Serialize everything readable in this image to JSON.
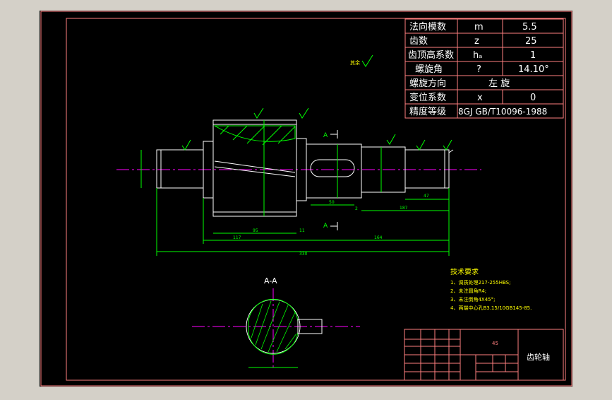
{
  "colors": {
    "app_bg": "#d4d0c8",
    "canvas_bg": "#000000",
    "frame": "#ff7f7f",
    "geometry": "#ffffff",
    "dimension": "#00ff00",
    "centerline": "#ff00ff",
    "hatch": "#00ff00",
    "text": "#ffffff"
  },
  "param_table": {
    "rows": [
      {
        "label": "法向模数",
        "symbol": "m",
        "value": "5.5"
      },
      {
        "label": "齿数",
        "symbol": "z",
        "value": "25"
      },
      {
        "label": "齿顶高系数",
        "symbol": "hₐ",
        "value": "1"
      },
      {
        "label": "螺旋角",
        "symbol": "?",
        "value": "14.10°"
      },
      {
        "label": "螺旋方向",
        "merged": "左  旋"
      },
      {
        "label": "变位系数",
        "symbol": "x",
        "value": "0"
      },
      {
        "label": "精度等级",
        "merged": "8GJ GB/T10096-1988"
      }
    ]
  },
  "section": {
    "label": "A-A",
    "marker_top": "A",
    "marker_bottom": "A"
  },
  "tech_req": {
    "title": "技术要求",
    "items": [
      "1、调质处理217-255HBS;",
      "2、未注圆角R4;",
      "3、未注倒角4X45°;",
      "4、两端中心孔B3.15/10GB145-85."
    ]
  },
  "title_block": {
    "part_name": "齿轮轴",
    "material": "45"
  },
  "dimensions": {
    "overall": "330",
    "d_117": "117",
    "d_164": "164",
    "d_187": "187",
    "d_47": "47",
    "d_95": "95",
    "d_50": "50",
    "d_11": "11",
    "d_2": "2"
  },
  "roughness_note": "其余"
}
